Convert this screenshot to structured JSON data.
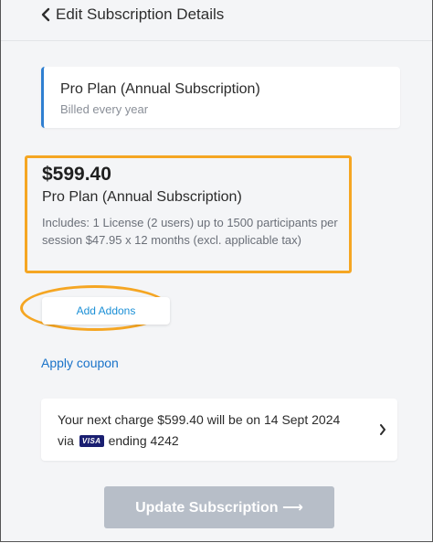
{
  "header": {
    "back_label": "Edit Subscription Details",
    "back_icon": "chevron-left-icon"
  },
  "current_plan": {
    "name": "Pro Plan (Annual Subscription)",
    "billing": "Billed every year",
    "accent_color": "#2f7fd1"
  },
  "summary": {
    "price": "$599.40",
    "plan": "Pro Plan (Annual Subscription)",
    "includes": "Includes: 1 License (2 users) up to 1500 participants per session $47.95 x 12 months (excl. applicable tax)",
    "highlight_color": "#f5a623"
  },
  "addons": {
    "label": "Add Addons"
  },
  "coupon": {
    "label": "Apply coupon"
  },
  "charge": {
    "line1": "Your next charge $599.40 will be on 14 Sept 2024",
    "via": "via",
    "card_brand": "VISA",
    "ending": "ending 4242",
    "chevron_icon": "chevron-right-icon"
  },
  "update": {
    "label": "Update Subscription ⟶"
  }
}
